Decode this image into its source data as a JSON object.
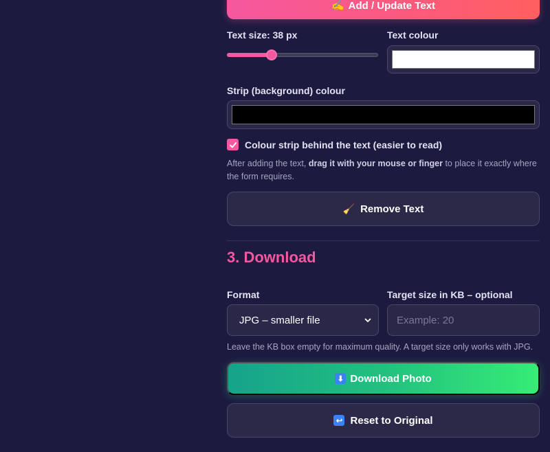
{
  "text_section": {
    "add_button_icon": "✍",
    "add_button_label": "Add / Update Text",
    "text_size_label": "Text size: 38 px",
    "text_size_value": 38,
    "text_size_fraction": 0.28,
    "text_colour_label": "Text colour",
    "text_colour_value": "#ffffff",
    "strip_colour_label": "Strip (background) colour",
    "strip_colour_value": "#000000",
    "strip_checkbox_label": "Colour strip behind the text (easier to read)",
    "strip_checkbox_checked": true,
    "help_prefix": "After adding the text, ",
    "help_bold": "drag it with your mouse or finger",
    "help_suffix": " to place it exactly where the form requires.",
    "remove_button_icon": "🧹",
    "remove_button_label": "Remove Text"
  },
  "download_section": {
    "title": "3. Download",
    "format_label": "Format",
    "format_selected": "JPG – smaller file",
    "target_size_label": "Target size in KB – optional",
    "target_size_placeholder": "Example: 20",
    "help_text": "Leave the KB box empty for maximum quality. A target size only works with JPG.",
    "download_button_label": "Download Photo",
    "reset_button_label": "Reset to Original"
  },
  "colors": {
    "accent_pink": "#f6589f",
    "download_green": "#22c07f",
    "background": "#1d1a3f"
  }
}
